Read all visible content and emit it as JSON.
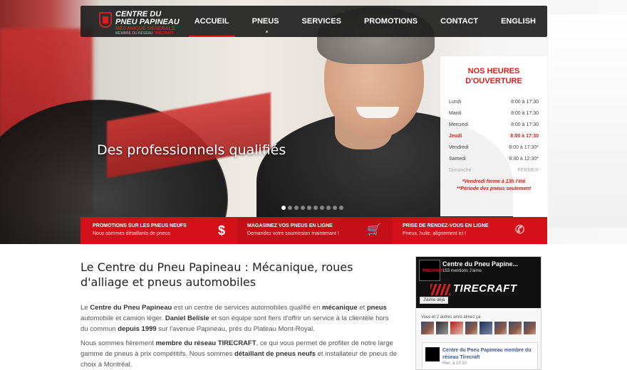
{
  "nav": {
    "logo": {
      "line1": "CENTRE DU",
      "line2": "PNEU PAPINEAU",
      "line3": "MÉCANIQUE GÉNÉRALE",
      "line4": "MEMBRE DU RÉSEAU",
      "line4_brand": "TIRECRAFT"
    },
    "items": [
      {
        "label": "ACCUEIL",
        "active": true
      },
      {
        "label": "PNEUS",
        "has_dropdown": true
      },
      {
        "label": "SERVICES"
      },
      {
        "label": "PROMOTIONS"
      },
      {
        "label": "CONTACT"
      },
      {
        "label": "ENGLISH"
      }
    ]
  },
  "hero": {
    "caption": "Des professionnels qualifiés",
    "slide_count": 10,
    "active_slide": 1
  },
  "hours": {
    "title_line1": "NOS HEURES",
    "title_line2": "D'OUVERTURE",
    "rows": [
      {
        "day": "Lundi",
        "time": "8:00 à 17:30"
      },
      {
        "day": "Mardi",
        "time": "8:00 à 17:30"
      },
      {
        "day": "Mercredi",
        "time": "8:00 à 17:30"
      },
      {
        "day": "Jeudi",
        "time": "8:00 à 17:30",
        "today": true
      },
      {
        "day": "Vendredi",
        "time": "8:00 à 17:30*"
      },
      {
        "day": "Samedi",
        "time": "8:30 à 12:30*"
      },
      {
        "day": "Dimanche",
        "time": "FERMER",
        "closed": true
      }
    ],
    "note1": "*Vendredi ferme à 13h l'été",
    "note2": "**Période des pneus seulement"
  },
  "redbar": [
    {
      "title": "PROMOTIONS SUR LES PNEUS NEUFS",
      "sub": "Nous sommes détaillants de pneus",
      "icon": "dollar-icon",
      "glyph": "$"
    },
    {
      "title": "MAGASINEZ VOS PNEUS EN LIGNE",
      "sub": "Demandez votre soumission maintenant !",
      "icon": "cart-icon",
      "glyph": "🛒"
    },
    {
      "title": "PRISE DE RENDEZ-VOUS EN LIGNE",
      "sub": "Pneus, huile, alignement ici !",
      "icon": "phone-icon",
      "glyph": "✆"
    }
  ],
  "content": {
    "heading": "Le Centre du Pneu Papineau : Mécanique, roues d'alliage et pneus automobiles",
    "p1": {
      "a": "Le ",
      "b1": "Centre du Pneu Papineau",
      "c": " est un centre de services automobiles qualifié en ",
      "b2": "mécanique",
      "d": " et ",
      "b3": "pneus",
      "e": " automobile et camion léger. ",
      "b4": "Daniel Belisle",
      "f": " et son équipe sont fiers d'offrir un service à la clientèle hors du commun ",
      "b5": "depuis 1999",
      "g": " sur l'avenue Papineau, près du Plateau Mont-Royal."
    },
    "p2": {
      "a": "Nous sommes fièrement ",
      "b1": "membre du réseau TIRECRAFT",
      "c": ", ce qui vous permet de profiter de notre large gamme de pneus à prix compétitifs. Nous sommes ",
      "b2": "détaillant de pneus neufs",
      "d": " et installateur de pneus de choix à Montréal."
    }
  },
  "facebook": {
    "page_name": "Centre du Pneu Papine...",
    "likes": "153 mentions J'aime",
    "cover_brand": "TIRECRAFT",
    "like_button": "J'aime déjà",
    "friends_text": "Vous et 2 autres amis aimez ça",
    "post_title": "Centre du Pneu Papineau membre du réseau Tirecraft",
    "post_date": "Hier, à 10:10"
  }
}
